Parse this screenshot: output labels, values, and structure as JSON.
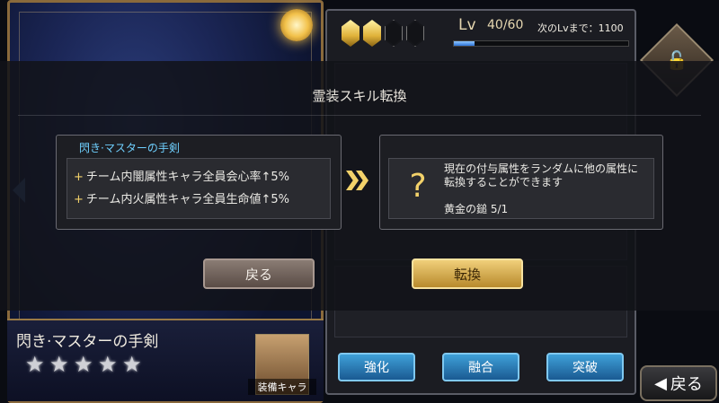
{
  "background": {
    "level": {
      "label": "Lv",
      "value": "40/60",
      "next_label": "次のLvまで：1100",
      "progress_fraction": 0.12,
      "gems_filled": 2,
      "gems_total": 4
    },
    "card_name": "閃き·マスターの手剣",
    "star_count": 5,
    "equip_chara_label": "装備キャラ",
    "tabs": [
      "強化",
      "融合",
      "突破"
    ],
    "back_button": "戻る",
    "colors": {
      "tab": "#2a7ab8",
      "gem": "#e0b23a"
    }
  },
  "modal": {
    "title": "霊装スキル転換",
    "skill": {
      "name": "閃き·マスターの手剣",
      "lines": [
        "チーム内闇属性キャラ全員会心率↑5%",
        "チーム内火属性キャラ全員生命値↑5%"
      ]
    },
    "result": {
      "icon": "?",
      "description": "現在の付与属性をランダムに他の属性に転換することができます",
      "item": "黄金の鎚  5/1"
    },
    "buttons": {
      "back": "戻る",
      "convert": "転換"
    },
    "colors": {
      "accent": "#f3d26a",
      "skill_name": "#6fd0ff"
    }
  }
}
